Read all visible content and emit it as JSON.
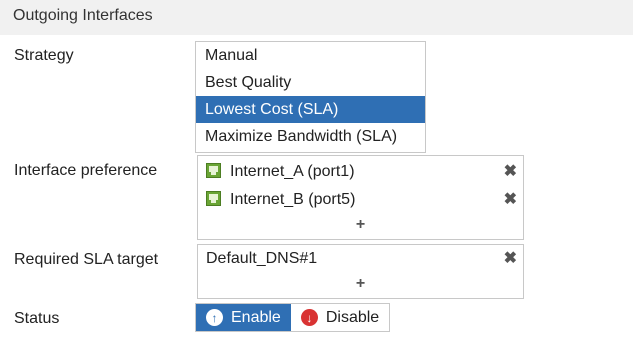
{
  "header": {
    "title": "Outgoing Interfaces"
  },
  "strategy": {
    "label": "Strategy",
    "options": [
      "Manual",
      "Best Quality",
      "Lowest Cost (SLA)",
      "Maximize Bandwidth (SLA)"
    ],
    "selected": "Lowest Cost (SLA)"
  },
  "interface_preference": {
    "label": "Interface preference",
    "items": [
      {
        "label": "Internet_A (port1)",
        "icon": "port-icon",
        "remove": "✖"
      },
      {
        "label": "Internet_B (port5)",
        "icon": "port-icon",
        "remove": "✖"
      }
    ],
    "add": "+"
  },
  "sla_target": {
    "label": "Required SLA target",
    "items": [
      {
        "label": "Default_DNS#1",
        "remove": "✖"
      }
    ],
    "add": "+"
  },
  "status": {
    "label": "Status",
    "enable": "Enable",
    "disable": "Disable",
    "active": "Enable"
  },
  "colors": {
    "accent": "#2f6fb4",
    "port_green": "#6aa535",
    "disable_red": "#d93333"
  }
}
